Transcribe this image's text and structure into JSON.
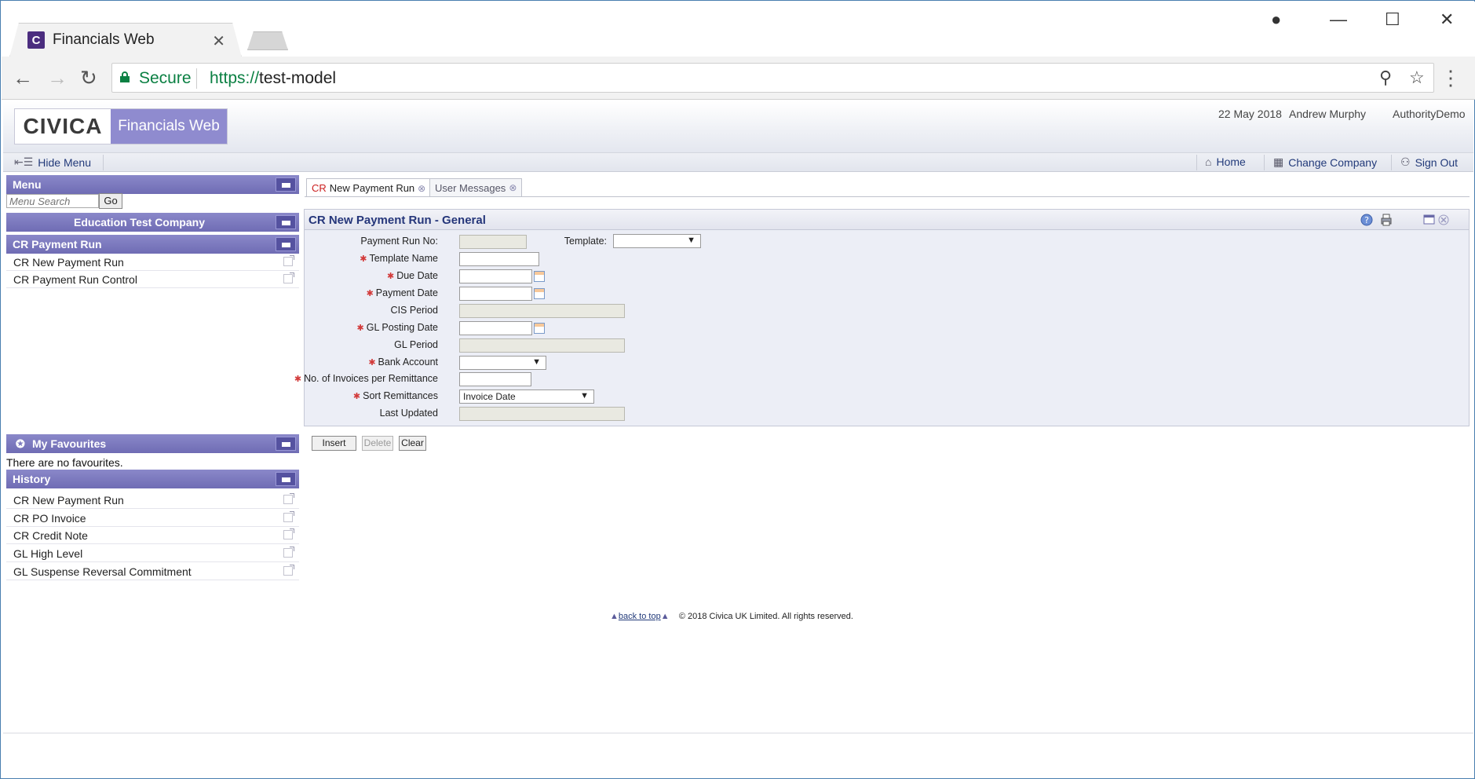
{
  "browser": {
    "tab_title": "Financials Web",
    "favicon_letter": "C",
    "secure_label": "Secure",
    "url_scheme": "https://",
    "url_host": "test-model"
  },
  "header": {
    "logo_left": "CIVICA",
    "logo_right": "Financials Web",
    "date": "22 May 2018",
    "user": "Andrew Murphy",
    "authority": "AuthorityDemo"
  },
  "menubar": {
    "hide_menu": "Hide Menu",
    "home": "Home",
    "change_company": "Change Company",
    "sign_out": "Sign Out"
  },
  "sidebar": {
    "menu_title": "Menu",
    "search_placeholder": "Menu Search",
    "go_label": "Go",
    "company": "Education Test Company",
    "section_title": "CR Payment Run",
    "items": [
      "CR New Payment Run",
      "CR Payment Run Control"
    ],
    "favourites_title": "My Favourites",
    "no_favourites": "There are no favourites.",
    "history_title": "History",
    "history": [
      "CR New Payment Run",
      "CR PO Invoice",
      "CR Credit Note",
      "GL High Level",
      "GL Suspense Reversal Commitment"
    ]
  },
  "content": {
    "tabs": {
      "active_prefix": "CR",
      "active_label": "New Payment Run",
      "other_label": "User Messages"
    },
    "form_title": "CR New Payment Run - General",
    "fields": {
      "payment_run_no": "Payment Run No:",
      "template": "Template:",
      "template_name": "Template Name",
      "due_date": "Due Date",
      "payment_date": "Payment Date",
      "cis_period": "CIS Period",
      "gl_posting_date": "GL Posting Date",
      "gl_period": "GL Period",
      "bank_account": "Bank Account",
      "invoices_per_remittance": "No. of Invoices per Remittance",
      "sort_remittances": "Sort Remittances",
      "sort_remittances_value": "Invoice Date",
      "last_updated": "Last Updated"
    },
    "buttons": {
      "insert": "Insert",
      "delete": "Delete",
      "clear": "Clear"
    }
  },
  "footer": {
    "back_to_top": "back to top",
    "copyright": "© 2018 Civica UK Limited. All rights reserved."
  },
  "colors": {
    "panel_header": "#7673b9",
    "link": "#223a7a",
    "required": "#d23a3a",
    "secure_green": "#0b8043"
  }
}
